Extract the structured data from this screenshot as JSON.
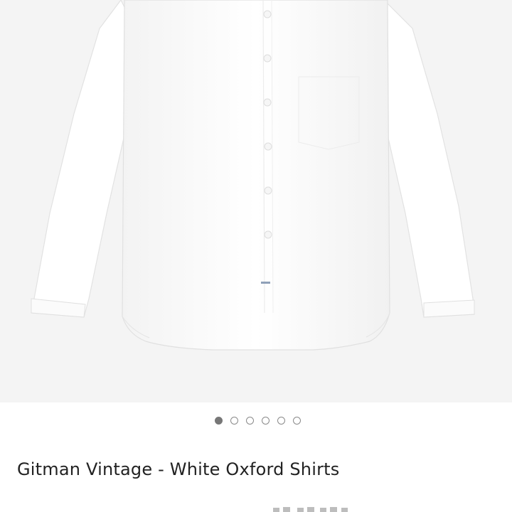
{
  "product": {
    "title": "Gitman Vintage - White Oxford Shirts",
    "image_alt": "White oxford shirt"
  },
  "gallery": {
    "image_count": 6,
    "active_index": 0
  },
  "colors": {
    "gallery_bg": "#f4f4f4",
    "shirt": "#ffffff",
    "dot_active": "#777777",
    "dot_border": "#8a8a8a",
    "title_text": "#222222"
  },
  "icons": {
    "dots": "carousel-indicator-dots"
  }
}
